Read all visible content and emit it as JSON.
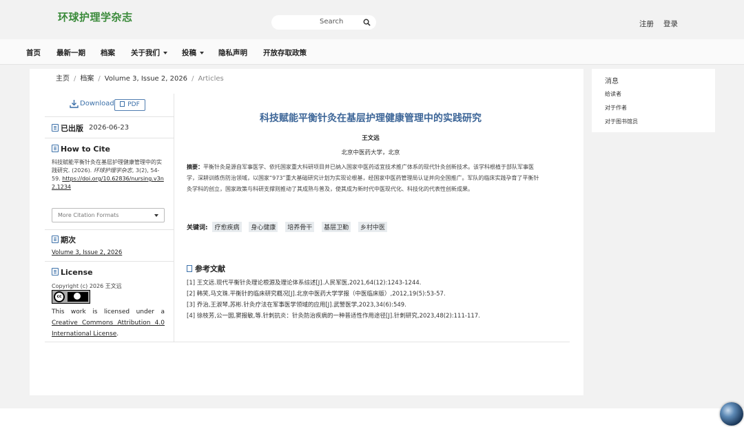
{
  "header": {
    "site_title": "环球护理学杂志",
    "search_label": "Search",
    "register": "注册",
    "login": "登录"
  },
  "nav": {
    "home": "首页",
    "current": "最新一期",
    "archive": "档案",
    "about": "关于我们",
    "submit": "投稿",
    "privacy": "隐私声明",
    "open_access": "开放存取政策"
  },
  "breadcrumb": {
    "home": "主页",
    "archive": "档案",
    "issue": "Volume 3, Issue 2, 2026",
    "current": "Articles"
  },
  "downloads": {
    "download_label": "Download",
    "pdf_label": "PDF"
  },
  "published": {
    "heading": "已出版",
    "date": "2026-06-23"
  },
  "how_to_cite": {
    "heading": "How to Cite",
    "text_plain": "科技赋能平衡针灸在基层护理健康管理中的实践研究. (2026). ",
    "journal_italic": "环球护理学杂志",
    "text_after": ", 3(2), 54-59. ",
    "doi": "https://doi.org/10.62836/nursing.v3n2.1234",
    "more_formats": "More Citation Formats"
  },
  "issue": {
    "heading": "期次",
    "link": "Volume 3, Issue 2, 2026"
  },
  "license": {
    "heading": "License",
    "copyright": "Copyright (c) 2026 王文远",
    "badge_text": "cc",
    "text_before": "This work is licensed under a ",
    "link": "Creative Commons Attribution 4.0 International License",
    "text_after": "."
  },
  "article": {
    "title": "科技赋能平衡针灸在基层护理健康管理中的实践研究",
    "author": "王文远",
    "affiliation": "北京中医药大学，北京",
    "abstract_label": "摘要：",
    "abstract_text": "平衡针灸是源自军事医学、依托国家重大科研项目并已纳入国家中医药适宜技术推广体系的现代针灸创新技术。该学科根植于部队军事医学，深耕训练伤防治领域，以国家“973”重大基础研究计划为实现论根基，经国家中医药管理局认证并向全国推广。军队的临床实践孕育了平衡针灸学科的创立，国家政策与科研支撑则推动了其成熟与普及，使其成为新时代中医现代化、科技化的代表性创新成果。",
    "keywords_label": "关键词:",
    "keywords": [
      "疗愈疾病",
      "身心健康",
      "培养骨干",
      "基层卫勤",
      "乡村中医"
    ],
    "refs_heading": "参考文献",
    "references": [
      "[1] 王文远.现代平衡针灸理论根源及理论体系综述[J].人民军医,2021,64(12):1243-1244.",
      "[2] 韩笑,马文珠.平衡针的临床研究概况[J].北京中医药大学学报（中医临床版）,2012,19(5):53-57.",
      "[3] 乔治,王淑琴,苏彬.针灸疗法在军事医学领域的应用[J].武警医学,2023,34(6):549.",
      "[4] 徐枝芳,公一囡,窦报敏,等.针刺抗炎：针灸防治疾病的一种普适性作用途径[J].针刺研究,2023,48(2):111-117."
    ]
  },
  "sidebar": {
    "title": "消息",
    "links": [
      "给读者",
      "对于作者",
      "对于图书馆员"
    ]
  }
}
